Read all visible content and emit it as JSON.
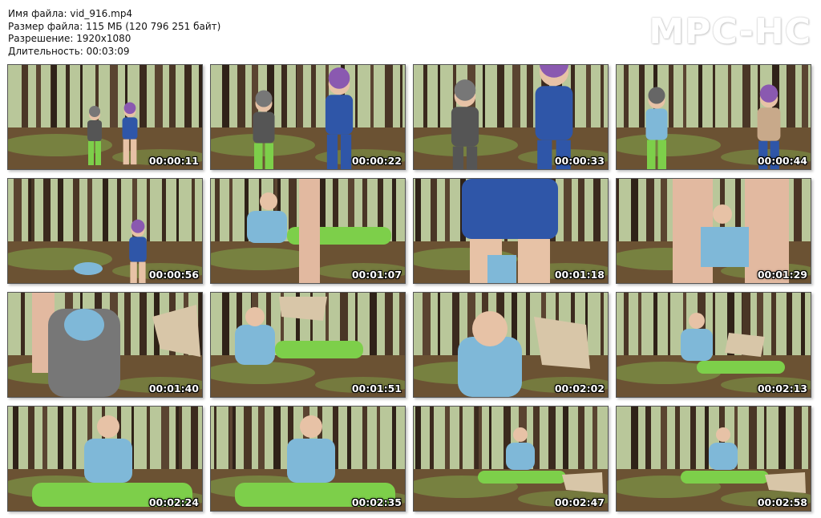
{
  "info": {
    "filename": "Имя файла: vid_916.mp4",
    "filesize": "Размер файла: 115 МБ (120 796 251 байт)",
    "resolution": "Разрешение: 1920x1080",
    "duration": "Длительность: 00:03:09"
  },
  "logo": "MPC-HC",
  "thumbnails": [
    {
      "time": "00:00:11",
      "scene": "standing-far"
    },
    {
      "time": "00:00:22",
      "scene": "standing-near"
    },
    {
      "time": "00:00:33",
      "scene": "standing-close"
    },
    {
      "time": "00:00:44",
      "scene": "standing-jacket"
    },
    {
      "time": "00:00:56",
      "scene": "fallen-far"
    },
    {
      "time": "00:01:07",
      "scene": "sitting-legs"
    },
    {
      "time": "00:01:18",
      "scene": "blue-shorts"
    },
    {
      "time": "00:01:29",
      "scene": "between-legs"
    },
    {
      "time": "00:01:40",
      "scene": "legs-closeup"
    },
    {
      "time": "00:01:51",
      "scene": "reclining"
    },
    {
      "time": "00:02:02",
      "scene": "face-closeup"
    },
    {
      "time": "00:02:13",
      "scene": "sitting-mid"
    },
    {
      "time": "00:02:24",
      "scene": "sitting-close"
    },
    {
      "time": "00:02:35",
      "scene": "sitting-close"
    },
    {
      "time": "00:02:47",
      "scene": "sitting-far"
    },
    {
      "time": "00:02:58",
      "scene": "sitting-far"
    }
  ],
  "colors": {
    "forest_floor": "#6b5233",
    "moss": "#7fa14a",
    "trunk": "#3b2a1e",
    "shirt": "#7fb8d8",
    "leggings": "#7dcf4a",
    "blue_top": "#2f56a8"
  }
}
